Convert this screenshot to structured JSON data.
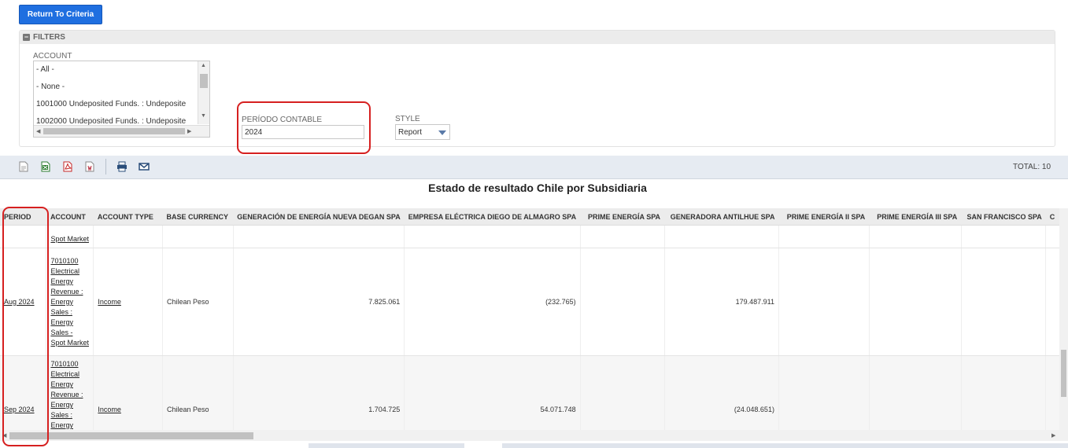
{
  "buttons": {
    "return_label": "Return To Criteria"
  },
  "filters": {
    "header": "FILTERS",
    "account": {
      "label": "ACCOUNT",
      "options": [
        "- All -",
        "- None -",
        "1001000 Undeposited Funds. : Undeposite",
        "1002000 Undeposited Funds. : Undeposite"
      ]
    },
    "periodo": {
      "label": "PERÍODO CONTABLE",
      "value": "2024"
    },
    "style": {
      "label": "STYLE",
      "value": "Report"
    }
  },
  "toolbar": {
    "total": "TOTAL: 10"
  },
  "report": {
    "title": "Estado de resultado Chile por Subsidiaria"
  },
  "table": {
    "columns": [
      "PERIOD",
      "ACCOUNT",
      "ACCOUNT TYPE",
      "BASE CURRENCY",
      "GENERACIÓN DE ENERGÍA NUEVA DEGAN SPA",
      "EMPRESA ELÉCTRICA DIEGO DE ALMAGRO SPA",
      "PRIME ENERGÍA SPA",
      "GENERADORA ANTILHUE SPA",
      "PRIME ENERGÍA II SPA",
      "PRIME ENERGÍA III SPA",
      "SAN FRANCISCO SPA",
      "C"
    ],
    "rows": [
      {
        "period": "",
        "account": "Spot Market",
        "type": "",
        "currency": "",
        "c1": "",
        "c2": "",
        "c3": "",
        "c4": ""
      },
      {
        "period": "Aug 2024",
        "account": "7010100 Electrical Energy Revenue : Energy Sales : Energy Sales - Spot Market",
        "type": "Income",
        "currency": "Chilean Peso",
        "c1": "7.825.061",
        "c2": "(232.765)",
        "c3": "",
        "c4": "179.487.911"
      },
      {
        "period": "Sep 2024",
        "account": "7010100 Electrical Energy Revenue : Energy Sales : Energy",
        "type": "Income",
        "currency": "Chilean Peso",
        "c1": "1.704.725",
        "c2": "54.071.748",
        "c3": "",
        "c4": "(24.048.651)"
      }
    ]
  }
}
